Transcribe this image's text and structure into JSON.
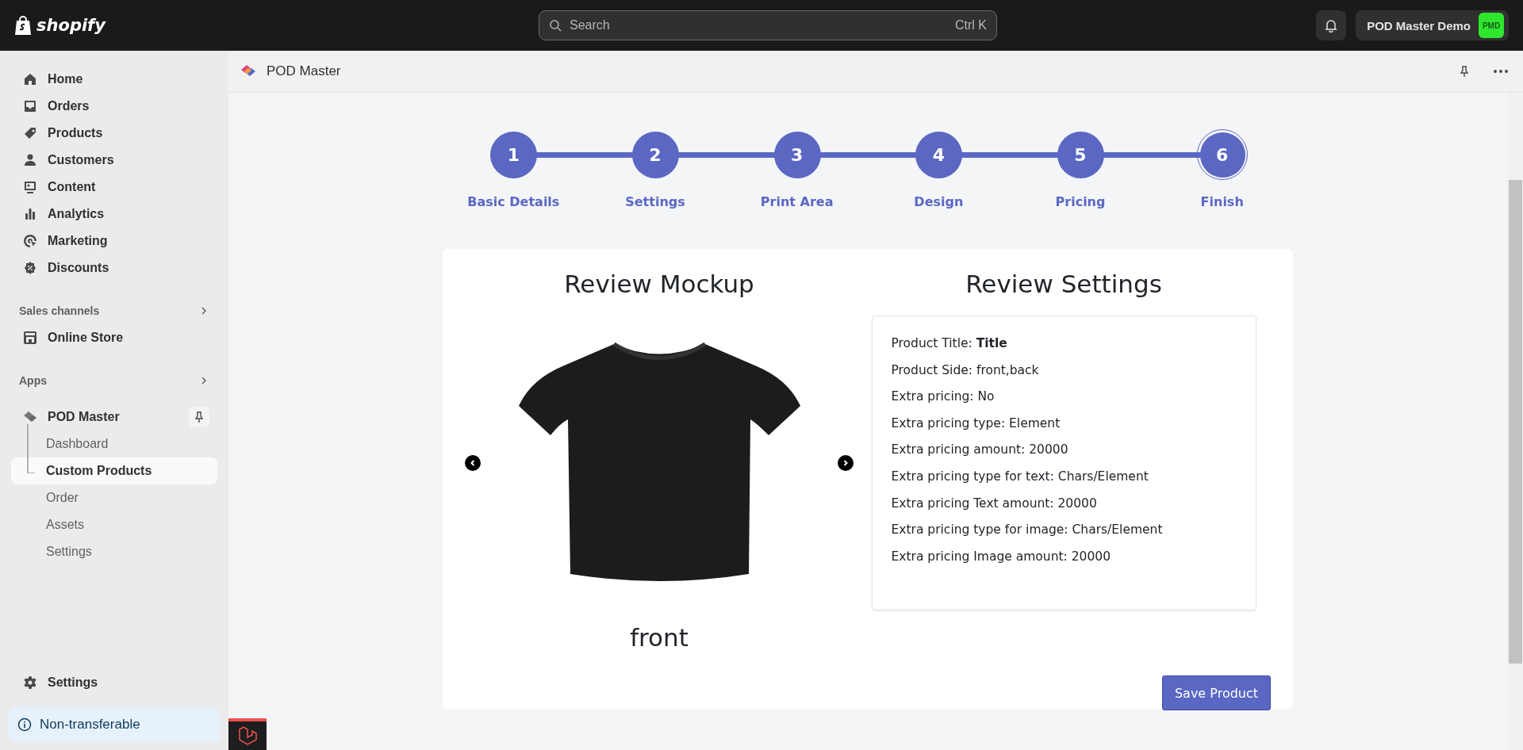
{
  "topbar": {
    "logo_text": "shopify",
    "search": {
      "placeholder": "Search",
      "shortcut": "Ctrl K"
    },
    "store": {
      "name": "POD Master Demo",
      "avatar": "PMD"
    }
  },
  "sidebar": {
    "items": [
      {
        "label": "Home"
      },
      {
        "label": "Orders"
      },
      {
        "label": "Products"
      },
      {
        "label": "Customers"
      },
      {
        "label": "Content"
      },
      {
        "label": "Analytics"
      },
      {
        "label": "Marketing"
      },
      {
        "label": "Discounts"
      }
    ],
    "sales_channels": {
      "heading": "Sales channels",
      "items": [
        {
          "label": "Online Store"
        }
      ]
    },
    "apps": {
      "heading": "Apps",
      "app": {
        "label": "POD Master",
        "children": [
          {
            "label": "Dashboard",
            "selected": false
          },
          {
            "label": "Custom Products",
            "selected": true
          },
          {
            "label": "Order",
            "selected": false
          },
          {
            "label": "Assets",
            "selected": false
          },
          {
            "label": "Settings",
            "selected": false
          }
        ]
      }
    },
    "settings": "Settings",
    "notice": "Non-transferable"
  },
  "app_header": {
    "title": "POD Master"
  },
  "stepper": {
    "steps": [
      {
        "number": "1",
        "label": "Basic Details",
        "selected": false
      },
      {
        "number": "2",
        "label": "Settings",
        "selected": false
      },
      {
        "number": "3",
        "label": "Print Area",
        "selected": false
      },
      {
        "number": "4",
        "label": "Design",
        "selected": false
      },
      {
        "number": "5",
        "label": "Pricing",
        "selected": false
      },
      {
        "number": "6",
        "label": "Finish",
        "selected": true
      }
    ]
  },
  "mockup": {
    "title": "Review Mockup",
    "caption": "front"
  },
  "review": {
    "title": "Review Settings",
    "lines": [
      "Product Title: **Title**",
      "Product Side: front,back",
      "Extra pricing: No",
      "Extra pricing type: Element",
      "Extra pricing amount: 20000",
      "Extra pricing type for text: Chars/Element",
      "Extra pricing Text amount: 20000",
      "Extra pricing type for image: Chars/Element",
      "Extra pricing Image amount: 20000"
    ]
  },
  "save_button": "Save Product"
}
